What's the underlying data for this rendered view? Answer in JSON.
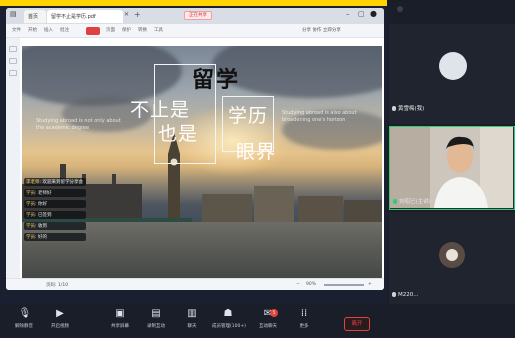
{
  "browser": {
    "tabs": [
      {
        "label": "首页"
      },
      {
        "label": "留学不止是学历.pdf"
      }
    ],
    "share_badge": "正在共享",
    "toolbar_items": [
      "文件",
      "开始",
      "插入",
      "批注",
      "页面",
      "保护",
      "转换",
      "工具"
    ],
    "toolbar_right": "分享 协作 立即分享"
  },
  "slide": {
    "title": "留学",
    "left_line1": "不止是",
    "left_line2": "也是",
    "right_line1": "学历",
    "right_line2": "眼界",
    "en_left_1": "Studying abroad is not only about",
    "en_left_2": "the academic degree",
    "en_right_1": "Studying abroad is also about",
    "en_right_2": "broadening one's horizon"
  },
  "chat": [
    {
      "who": "李老师",
      "text": "欢迎来到留学分享会"
    },
    {
      "who": "学员",
      "text": "老师好"
    },
    {
      "who": "学员",
      "text": "你好"
    },
    {
      "who": "学员",
      "text": "已签到"
    },
    {
      "who": "学员",
      "text": "收到"
    },
    {
      "who": "学员",
      "text": "好的"
    }
  ],
  "statusbar": {
    "page": "页码: 1/10",
    "zoom": "90%"
  },
  "participants": [
    {
      "name": "黄雪梅(我)",
      "muted": true
    },
    {
      "name": "刘昭已(主讲)",
      "muted": false
    },
    {
      "name": "M220...",
      "muted": true
    }
  ],
  "bottombar": {
    "buttons": [
      {
        "label": "解除静音",
        "icon": "mic-icon"
      },
      {
        "label": "开启视频",
        "icon": "video-icon"
      },
      {
        "label": "共享屏幕",
        "icon": "share-screen-icon"
      },
      {
        "label": "录制互动",
        "icon": "record-icon"
      },
      {
        "label": "聊天",
        "icon": "chat-icon"
      },
      {
        "label": "成员管理(100+)",
        "icon": "members-icon"
      },
      {
        "label": "互动聊天",
        "icon": "chat-bubble-icon"
      },
      {
        "label": "更多",
        "icon": "more-icon"
      }
    ],
    "end_label": "离开",
    "chat_badge": "5"
  },
  "colors": {
    "accent_green": "#2ecc71",
    "end_red": "#e0443c",
    "top_strip": "#ffd400"
  }
}
